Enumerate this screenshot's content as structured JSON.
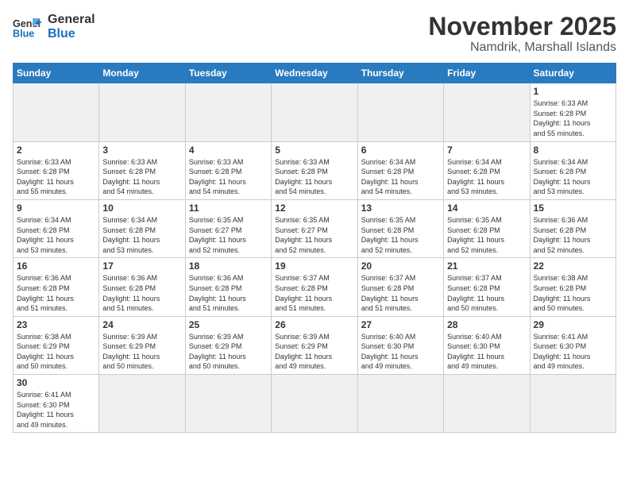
{
  "header": {
    "logo_general": "General",
    "logo_blue": "Blue",
    "title": "November 2025",
    "subtitle": "Namdrik, Marshall Islands"
  },
  "weekdays": [
    "Sunday",
    "Monday",
    "Tuesday",
    "Wednesday",
    "Thursday",
    "Friday",
    "Saturday"
  ],
  "days": {
    "1": {
      "sunrise": "6:33 AM",
      "sunset": "6:28 PM",
      "daylight": "11 hours and 55 minutes."
    },
    "2": {
      "sunrise": "6:33 AM",
      "sunset": "6:28 PM",
      "daylight": "11 hours and 55 minutes."
    },
    "3": {
      "sunrise": "6:33 AM",
      "sunset": "6:28 PM",
      "daylight": "11 hours and 54 minutes."
    },
    "4": {
      "sunrise": "6:33 AM",
      "sunset": "6:28 PM",
      "daylight": "11 hours and 54 minutes."
    },
    "5": {
      "sunrise": "6:33 AM",
      "sunset": "6:28 PM",
      "daylight": "11 hours and 54 minutes."
    },
    "6": {
      "sunrise": "6:34 AM",
      "sunset": "6:28 PM",
      "daylight": "11 hours and 54 minutes."
    },
    "7": {
      "sunrise": "6:34 AM",
      "sunset": "6:28 PM",
      "daylight": "11 hours and 53 minutes."
    },
    "8": {
      "sunrise": "6:34 AM",
      "sunset": "6:28 PM",
      "daylight": "11 hours and 53 minutes."
    },
    "9": {
      "sunrise": "6:34 AM",
      "sunset": "6:28 PM",
      "daylight": "11 hours and 53 minutes."
    },
    "10": {
      "sunrise": "6:34 AM",
      "sunset": "6:28 PM",
      "daylight": "11 hours and 53 minutes."
    },
    "11": {
      "sunrise": "6:35 AM",
      "sunset": "6:27 PM",
      "daylight": "11 hours and 52 minutes."
    },
    "12": {
      "sunrise": "6:35 AM",
      "sunset": "6:27 PM",
      "daylight": "11 hours and 52 minutes."
    },
    "13": {
      "sunrise": "6:35 AM",
      "sunset": "6:28 PM",
      "daylight": "11 hours and 52 minutes."
    },
    "14": {
      "sunrise": "6:35 AM",
      "sunset": "6:28 PM",
      "daylight": "11 hours and 52 minutes."
    },
    "15": {
      "sunrise": "6:36 AM",
      "sunset": "6:28 PM",
      "daylight": "11 hours and 52 minutes."
    },
    "16": {
      "sunrise": "6:36 AM",
      "sunset": "6:28 PM",
      "daylight": "11 hours and 51 minutes."
    },
    "17": {
      "sunrise": "6:36 AM",
      "sunset": "6:28 PM",
      "daylight": "11 hours and 51 minutes."
    },
    "18": {
      "sunrise": "6:36 AM",
      "sunset": "6:28 PM",
      "daylight": "11 hours and 51 minutes."
    },
    "19": {
      "sunrise": "6:37 AM",
      "sunset": "6:28 PM",
      "daylight": "11 hours and 51 minutes."
    },
    "20": {
      "sunrise": "6:37 AM",
      "sunset": "6:28 PM",
      "daylight": "11 hours and 51 minutes."
    },
    "21": {
      "sunrise": "6:37 AM",
      "sunset": "6:28 PM",
      "daylight": "11 hours and 50 minutes."
    },
    "22": {
      "sunrise": "6:38 AM",
      "sunset": "6:28 PM",
      "daylight": "11 hours and 50 minutes."
    },
    "23": {
      "sunrise": "6:38 AM",
      "sunset": "6:29 PM",
      "daylight": "11 hours and 50 minutes."
    },
    "24": {
      "sunrise": "6:39 AM",
      "sunset": "6:29 PM",
      "daylight": "11 hours and 50 minutes."
    },
    "25": {
      "sunrise": "6:39 AM",
      "sunset": "6:29 PM",
      "daylight": "11 hours and 50 minutes."
    },
    "26": {
      "sunrise": "6:39 AM",
      "sunset": "6:29 PM",
      "daylight": "11 hours and 49 minutes."
    },
    "27": {
      "sunrise": "6:40 AM",
      "sunset": "6:30 PM",
      "daylight": "11 hours and 49 minutes."
    },
    "28": {
      "sunrise": "6:40 AM",
      "sunset": "6:30 PM",
      "daylight": "11 hours and 49 minutes."
    },
    "29": {
      "sunrise": "6:41 AM",
      "sunset": "6:30 PM",
      "daylight": "11 hours and 49 minutes."
    },
    "30": {
      "sunrise": "6:41 AM",
      "sunset": "6:30 PM",
      "daylight": "11 hours and 49 minutes."
    }
  }
}
